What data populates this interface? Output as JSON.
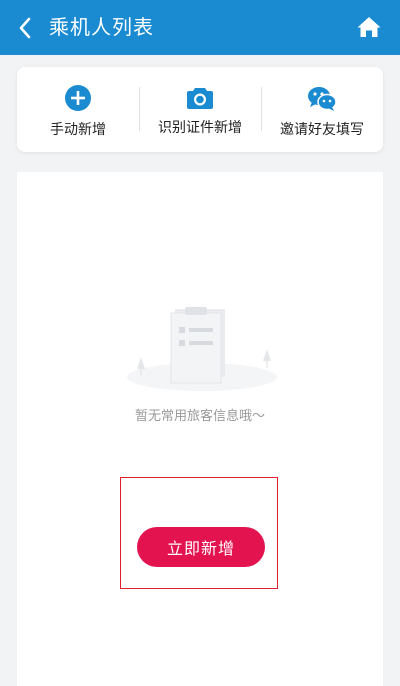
{
  "header": {
    "title": "乘机人列表",
    "back_icon": "chevron-left-icon",
    "home_icon": "home-icon"
  },
  "actions": [
    {
      "label": "手动新增",
      "icon": "plus-circle-icon"
    },
    {
      "label": "识别证件新增",
      "icon": "camera-icon"
    },
    {
      "label": "邀请好友填写",
      "icon": "wechat-icon"
    }
  ],
  "empty_state": {
    "message": "暂无常用旅客信息哦～",
    "illustration": "empty-clipboard-illustration"
  },
  "add_button": {
    "label": "立即新增"
  },
  "colors": {
    "primary": "#1a8ad1",
    "accent": "#e3134f",
    "highlight": "#e0202e"
  }
}
